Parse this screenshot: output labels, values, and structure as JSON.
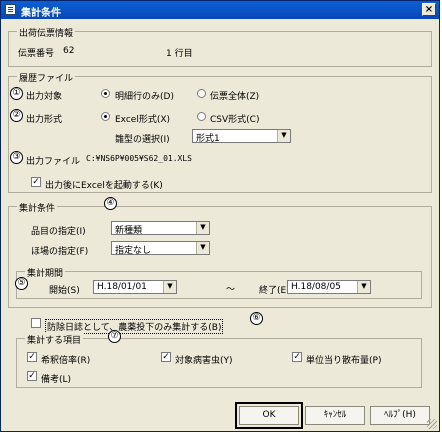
{
  "window": {
    "title": "集計条件",
    "close_glyph": "×"
  },
  "shipment": {
    "legend": "出荷伝票情報",
    "label": "伝票番号",
    "number": "62",
    "line_info": "1 行目"
  },
  "history": {
    "legend": "履歴ファイル",
    "target_label": "出力対象",
    "target_options": [
      "明細行のみ(D)",
      "伝票全体(Z)"
    ],
    "target_selected": 0,
    "format_label": "出力形式",
    "format_options": [
      "Excel形式(X)",
      "CSV形式(C)"
    ],
    "format_selected": 0,
    "template_label": "雛型の選択(I)",
    "template_value": "形式1",
    "file_label": "出力ファイル",
    "file_path": "C:¥NS6P¥005¥S62_01.XLS",
    "launch_excel_label": "出力後にExcelを起動する(K)",
    "launch_excel_checked": true
  },
  "aggregate": {
    "legend": "集計条件",
    "item_label": "品目の指定(I)",
    "item_value": "新種類",
    "field_label": "ほ場の指定(F)",
    "field_value": "指定なし",
    "period_legend": "集計期間",
    "start_label": "開始(S)",
    "start_value": "H.18/01/01",
    "tilde": "〜",
    "end_label": "終了(E)",
    "end_value": "H.18/08/05"
  },
  "pesticide_only": {
    "label": "防除日誌として、農薬投下のみ集計する(B)",
    "checked": false
  },
  "items": {
    "legend": "集計する項目",
    "checks": [
      {
        "label": "希釈倍率(R)",
        "checked": true
      },
      {
        "label": "対象病害虫(Y)",
        "checked": true
      },
      {
        "label": "単位当り散布量(P)",
        "checked": true
      },
      {
        "label": "備考(L)",
        "checked": true
      }
    ]
  },
  "annotations": [
    "①",
    "②",
    "③",
    "④",
    "⑤",
    "⑥",
    "⑦"
  ],
  "buttons": {
    "ok": "OK",
    "cancel": "ｷｬﾝｾﾙ",
    "help": "ﾍﾙﾌﾟ(H)"
  },
  "combo_arrow": "▼",
  "check_glyph": "✓"
}
